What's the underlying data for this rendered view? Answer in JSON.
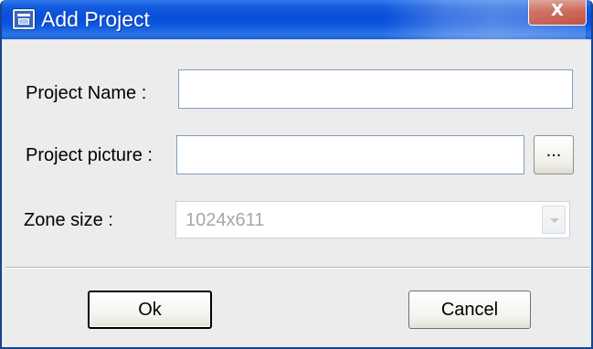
{
  "window": {
    "title": "Add Project",
    "close_glyph": "X",
    "icon": "app-window-icon"
  },
  "form": {
    "project_name": {
      "label": "Project Name :",
      "value": ""
    },
    "project_picture": {
      "label": "Project picture :",
      "value": "",
      "browse_label": "..."
    },
    "zone_size": {
      "label": "Zone size :",
      "selected": "1024x611",
      "disabled": true
    }
  },
  "buttons": {
    "ok_label": "Ok",
    "cancel_label": "Cancel"
  },
  "colors": {
    "titlebar": "#0a4ed8",
    "close_button": "#c14635",
    "dialog_background": "#ececec",
    "field_border": "#7f9db9",
    "disabled_text": "#a7a7a7"
  }
}
